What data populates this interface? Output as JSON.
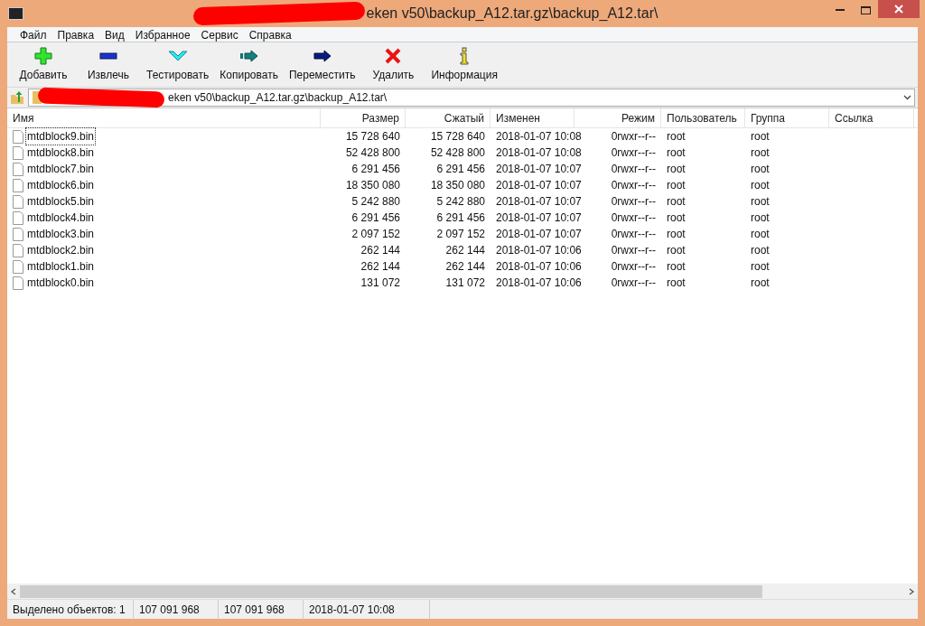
{
  "window": {
    "title": "eken v50\\backup_A12.tar.gz\\backup_A12.tar\\"
  },
  "menu": [
    "Файл",
    "Правка",
    "Вид",
    "Избранное",
    "Сервис",
    "Справка"
  ],
  "toolbar": [
    {
      "kind": "add",
      "label": "Добавить"
    },
    {
      "kind": "extract",
      "label": "Извлечь"
    },
    {
      "kind": "test",
      "label": "Тестировать"
    },
    {
      "kind": "copy",
      "label": "Копировать"
    },
    {
      "kind": "move",
      "label": "Переместить"
    },
    {
      "kind": "delete",
      "label": "Удалить"
    },
    {
      "kind": "info",
      "label": "Информация"
    }
  ],
  "address": {
    "value": "eken v50\\backup_A12.tar.gz\\backup_A12.tar\\"
  },
  "table": {
    "columns": [
      "Имя",
      "Размер",
      "Сжатый",
      "Изменен",
      "Режим",
      "Пользователь",
      "Группа",
      "Ссылка"
    ],
    "rows": [
      {
        "selected": true,
        "cells": [
          "mtdblock9.bin",
          "15 728 640",
          "15 728 640",
          "2018-01-07 10:08",
          "0rwxr--r--",
          "root",
          "root"
        ]
      },
      {
        "selected": false,
        "cells": [
          "mtdblock8.bin",
          "52 428 800",
          "52 428 800",
          "2018-01-07 10:08",
          "0rwxr--r--",
          "root",
          "root"
        ]
      },
      {
        "selected": false,
        "cells": [
          "mtdblock7.bin",
          "6 291 456",
          "6 291 456",
          "2018-01-07 10:07",
          "0rwxr--r--",
          "root",
          "root"
        ]
      },
      {
        "selected": false,
        "cells": [
          "mtdblock6.bin",
          "18 350 080",
          "18 350 080",
          "2018-01-07 10:07",
          "0rwxr--r--",
          "root",
          "root"
        ]
      },
      {
        "selected": false,
        "cells": [
          "mtdblock5.bin",
          "5 242 880",
          "5 242 880",
          "2018-01-07 10:07",
          "0rwxr--r--",
          "root",
          "root"
        ]
      },
      {
        "selected": false,
        "cells": [
          "mtdblock4.bin",
          "6 291 456",
          "6 291 456",
          "2018-01-07 10:07",
          "0rwxr--r--",
          "root",
          "root"
        ]
      },
      {
        "selected": false,
        "cells": [
          "mtdblock3.bin",
          "2 097 152",
          "2 097 152",
          "2018-01-07 10:07",
          "0rwxr--r--",
          "root",
          "root"
        ]
      },
      {
        "selected": false,
        "cells": [
          "mtdblock2.bin",
          "262 144",
          "262 144",
          "2018-01-07 10:06",
          "0rwxr--r--",
          "root",
          "root"
        ]
      },
      {
        "selected": false,
        "cells": [
          "mtdblock1.bin",
          "262 144",
          "262 144",
          "2018-01-07 10:06",
          "0rwxr--r--",
          "root",
          "root"
        ]
      },
      {
        "selected": false,
        "cells": [
          "mtdblock0.bin",
          "131 072",
          "131 072",
          "2018-01-07 10:06",
          "0rwxr--r--",
          "root",
          "root"
        ]
      }
    ]
  },
  "status_bar": [
    "Выделено объектов: 1",
    "107 091 968",
    "107 091 968",
    "2018-01-07 10:08"
  ]
}
